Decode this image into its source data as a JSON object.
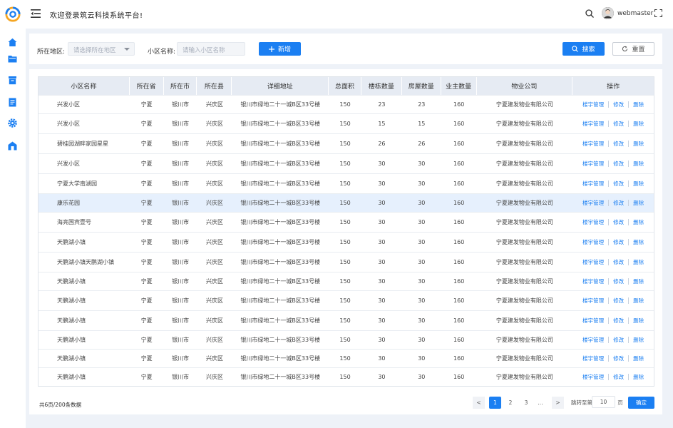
{
  "header": {
    "welcome": "欢迎登录筑云科技系统平台!",
    "username": "webmaster"
  },
  "sidebar": {
    "icons": [
      "home-icon",
      "folder-icon",
      "archive-icon",
      "document-icon",
      "settings-icon",
      "building-icon"
    ]
  },
  "filters": {
    "region_label": "所在地区:",
    "region_placeholder": "请选择所在地区",
    "community_label": "小区名称:",
    "community_placeholder": "请输入小区名称",
    "add_label": "新增",
    "search_label": "搜索",
    "reset_label": "重置"
  },
  "table": {
    "columns": [
      "小区名称",
      "所在省",
      "所在市",
      "所在县",
      "详细地址",
      "总面积",
      "楼栋数量",
      "房屋数量",
      "业主数量",
      "物业公司",
      "操作"
    ],
    "op_labels": [
      "楼宇管理",
      "修改",
      "删除"
    ],
    "rows": [
      {
        "name": "兴发小区",
        "province": "宁夏",
        "city": "银川市",
        "county": "兴庆区",
        "address": "银川市绿地二十一城B区33号楼",
        "area": "150",
        "buildings": "23",
        "houses": "23",
        "owners": "160",
        "company": "宁夏建发物业有限公司"
      },
      {
        "name": "兴发小区",
        "province": "宁夏",
        "city": "银川市",
        "county": "兴庆区",
        "address": "银川市绿地二十一城B区33号楼",
        "area": "150",
        "buildings": "15",
        "houses": "15",
        "owners": "160",
        "company": "宁夏建发物业有限公司"
      },
      {
        "name": "碧桂园湖畔家园星星",
        "province": "宁夏",
        "city": "银川市",
        "county": "兴庆区",
        "address": "银川市绿地二十一城B区33号楼",
        "area": "150",
        "buildings": "26",
        "houses": "26",
        "owners": "160",
        "company": "宁夏建发物业有限公司"
      },
      {
        "name": "兴发小区",
        "province": "宁夏",
        "city": "银川市",
        "county": "兴庆区",
        "address": "银川市绿地二十一城B区33号楼",
        "area": "150",
        "buildings": "30",
        "houses": "30",
        "owners": "160",
        "company": "宁夏建发物业有限公司"
      },
      {
        "name": "宁夏大学南湖园",
        "province": "宁夏",
        "city": "银川市",
        "county": "兴庆区",
        "address": "银川市绿地二十一城B区33号楼",
        "area": "150",
        "buildings": "30",
        "houses": "30",
        "owners": "160",
        "company": "宁夏建发物业有限公司"
      },
      {
        "name": "康乐花园",
        "province": "宁夏",
        "city": "银川市",
        "county": "兴庆区",
        "address": "银川市绿地二十一城B区33号楼",
        "area": "150",
        "buildings": "30",
        "houses": "30",
        "owners": "160",
        "company": "宁夏建发物业有限公司"
      },
      {
        "name": "海亮国宾壹号",
        "province": "宁夏",
        "city": "银川市",
        "county": "兴庆区",
        "address": "银川市绿地二十一城B区33号楼",
        "area": "150",
        "buildings": "30",
        "houses": "30",
        "owners": "160",
        "company": "宁夏建发物业有限公司"
      },
      {
        "name": "天鹏湖小镇",
        "province": "宁夏",
        "city": "银川市",
        "county": "兴庆区",
        "address": "银川市绿地二十一城B区33号楼",
        "area": "150",
        "buildings": "30",
        "houses": "30",
        "owners": "160",
        "company": "宁夏建发物业有限公司"
      },
      {
        "name": "天鹏湖小镇天鹏湖小镇",
        "province": "宁夏",
        "city": "银川市",
        "county": "兴庆区",
        "address": "银川市绿地二十一城B区33号楼",
        "area": "150",
        "buildings": "30",
        "houses": "30",
        "owners": "160",
        "company": "宁夏建发物业有限公司"
      },
      {
        "name": "天鹏湖小镇",
        "province": "宁夏",
        "city": "银川市",
        "county": "兴庆区",
        "address": "银川市绿地二十一城B区33号楼",
        "area": "150",
        "buildings": "30",
        "houses": "30",
        "owners": "160",
        "company": "宁夏建发物业有限公司"
      },
      {
        "name": "天鹏湖小镇",
        "province": "宁夏",
        "city": "银川市",
        "county": "兴庆区",
        "address": "银川市绿地二十一城B区33号楼",
        "area": "150",
        "buildings": "30",
        "houses": "30",
        "owners": "160",
        "company": "宁夏建发物业有限公司"
      },
      {
        "name": "天鹏湖小镇",
        "province": "宁夏",
        "city": "银川市",
        "county": "兴庆区",
        "address": "银川市绿地二十一城B区33号楼",
        "area": "150",
        "buildings": "30",
        "houses": "30",
        "owners": "160",
        "company": "宁夏建发物业有限公司"
      },
      {
        "name": "天鹏湖小镇",
        "province": "宁夏",
        "city": "银川市",
        "county": "兴庆区",
        "address": "银川市绿地二十一城B区33号楼",
        "area": "150",
        "buildings": "30",
        "houses": "30",
        "owners": "160",
        "company": "宁夏建发物业有限公司"
      },
      {
        "name": "天鹏湖小镇",
        "province": "宁夏",
        "city": "银川市",
        "county": "兴庆区",
        "address": "银川市绿地二十一城B区33号楼",
        "area": "150",
        "buildings": "30",
        "houses": "30",
        "owners": "160",
        "company": "宁夏建发物业有限公司"
      },
      {
        "name": "天鹏湖小镇",
        "province": "宁夏",
        "city": "银川市",
        "county": "兴庆区",
        "address": "银川市绿地二十一城B区33号楼",
        "area": "150",
        "buildings": "30",
        "houses": "30",
        "owners": "160",
        "company": "宁夏建发物业有限公司"
      }
    ],
    "selected_row": 5
  },
  "footer": {
    "total_text": "共6页/200条数据",
    "prev": "<",
    "next": ">",
    "pages": [
      "1",
      "2",
      "3",
      "..."
    ],
    "current_page": "1",
    "jump_label": "跳转至第",
    "jump_value": "10",
    "page_unit": "页",
    "confirm_label": "确定"
  },
  "colors": {
    "primary": "#1b7ff2",
    "header_bg": "#e6ebf3",
    "selected_row": "#e6f0fd"
  }
}
